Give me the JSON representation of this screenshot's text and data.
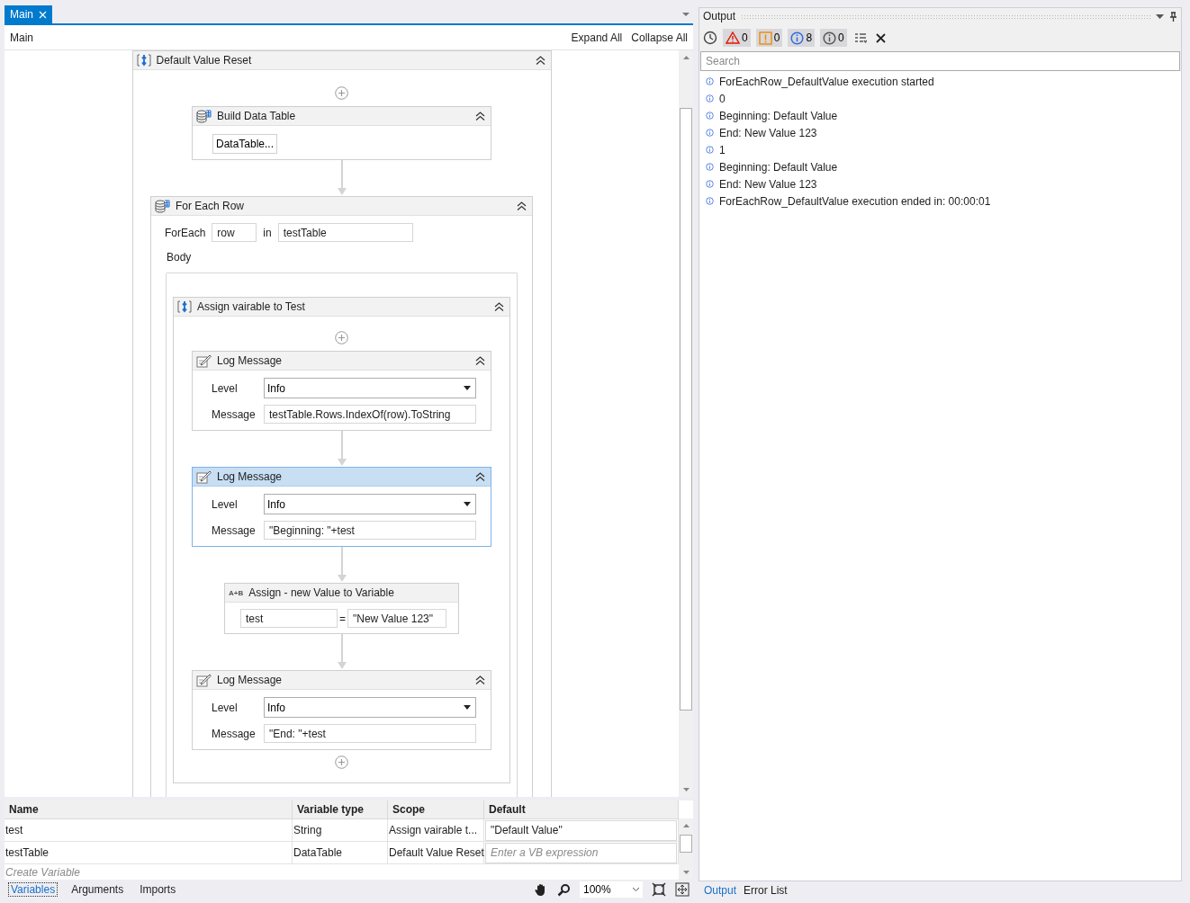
{
  "document_tabs": [
    {
      "label": "Main",
      "selected": true
    }
  ],
  "breadcrumb": "Main",
  "designer_actions": [
    "Expand All",
    "Collapse All"
  ],
  "workflow": {
    "kind": "sequence",
    "title": "Default Value Reset",
    "children": [
      {
        "kind": "build_data_table",
        "title": "Build Data Table",
        "button": "DataTable..."
      },
      {
        "kind": "for_each_row",
        "title": "For Each Row",
        "foreach_label": "ForEach",
        "item": "row",
        "in_label": "in",
        "collection": "testTable",
        "body_label": "Body",
        "body": {
          "kind": "sequence",
          "title": "Assign vairable to Test",
          "children": [
            {
              "kind": "log_message",
              "title": "Log Message",
              "selected": false,
              "level_label": "Level",
              "log_level": "Info",
              "message_label": "Message",
              "message": "testTable.Rows.IndexOf(row).ToString"
            },
            {
              "kind": "log_message",
              "title": "Log Message",
              "selected": true,
              "level_label": "Level",
              "log_level": "Info",
              "message_label": "Message",
              "message": "\"Beginning: \"+test"
            },
            {
              "kind": "assign",
              "title": "Assign - new Value to Variable",
              "icon_text": "A+B",
              "to": "test",
              "equals": "=",
              "value": "\"New Value 123\""
            },
            {
              "kind": "log_message",
              "title": "Log Message",
              "selected": false,
              "level_label": "Level",
              "log_level": "Info",
              "message_label": "Message",
              "message": "\"End: \"+test"
            }
          ]
        }
      }
    ]
  },
  "variables": {
    "columns": [
      "Name",
      "Variable type",
      "Scope",
      "Default"
    ],
    "rows": [
      {
        "name": "test",
        "type": "String",
        "scope": "Assign vairable t...",
        "default": "\"Default Value\""
      },
      {
        "name": "testTable",
        "type": "DataTable",
        "scope": "Default Value Reset",
        "default_placeholder": "Enter a VB expression"
      }
    ],
    "create_placeholder": "Create Variable"
  },
  "bottom_tabs": [
    {
      "label": "Variables",
      "selected": true
    },
    {
      "label": "Arguments",
      "selected": false
    },
    {
      "label": "Imports",
      "selected": false
    }
  ],
  "zoom": "100%",
  "output": {
    "title": "Output",
    "filters": [
      {
        "kind": "error",
        "count": "0",
        "on": true
      },
      {
        "kind": "warning",
        "count": "0",
        "on": true
      },
      {
        "kind": "info",
        "count": "8",
        "on": true
      },
      {
        "kind": "trace",
        "count": "0",
        "on": true
      }
    ],
    "search_placeholder": "Search",
    "lines": [
      "ForEachRow_DefaultValue execution started",
      "0",
      "Beginning: Default Value",
      "End: New Value 123",
      "1",
      "Beginning: Default Value",
      "End: New Value 123",
      "ForEachRow_DefaultValue execution ended in: 00:00:01"
    ],
    "tabs": [
      {
        "label": "Output",
        "selected": true
      },
      {
        "label": "Error List",
        "selected": false
      }
    ]
  }
}
